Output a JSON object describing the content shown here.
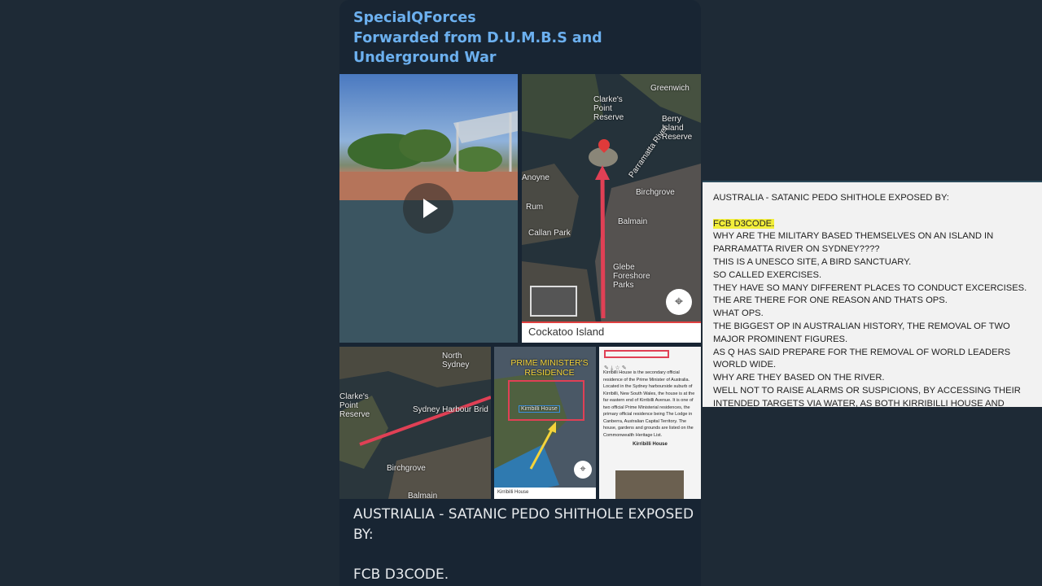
{
  "message": {
    "channel": "SpecialQForces",
    "forwarded_from": "Forwarded from D.U.M.B.S and Underground War",
    "caption_line1": "AUSTRIALIA - SATANIC PEDO SHITHOLE EXPOSED BY:",
    "caption_line2": "FCB D3CODE."
  },
  "media": {
    "map1": {
      "labels": [
        "Greenwich",
        "Clarke's Point Reserve",
        "Berry Island Reserve",
        "Parramatta River",
        "Birchgrove",
        "Balmain",
        "Callan Park",
        "Rum",
        "Glebe Foreshore Parks",
        "Anoyne"
      ],
      "place_box": "Cockatoo Island"
    },
    "map2": {
      "labels": [
        "North Sydney",
        "Clarke's Point Reserve",
        "Sydney Harbour Brid",
        "Birchgrove",
        "Balmain"
      ]
    },
    "map3": {
      "title": "PRIME MINISTER'S RESIDENCE",
      "label": "Kirribilli House",
      "bottom_label": "Kirribilli House"
    },
    "wiki": {
      "text": "Kirribilli House is the secondary official residence of the Prime Minister of Australia. Located in the Sydney harbourside suburb of Kirribilli, New South Wales, the house is at the far eastern end of Kirribilli Avenue. It is one of two official Prime Ministerial residences, the primary official residence being The Lodge in Canberra, Australian Capital Territory. The house, gardens and grounds are listed on the Commonwealth Heritage List.",
      "caption": "Kirribilli House"
    }
  },
  "panel": {
    "title": "AUSTRALIA - SATANIC PEDO SHITHOLE EXPOSED BY:",
    "highlight": "FCB D3CODE.",
    "lines": [
      "WHY ARE THE MILITARY BASED THEMSELVES ON AN ISLAND IN PARRAMATTA RIVER ON SYDNEY????",
      "THIS IS A UNESCO SITE, A BIRD SANCTUARY.",
      "SO CALLED EXERCISES.",
      "THEY HAVE SO MANY DIFFERENT PLACES TO CONDUCT EXCERCISES.",
      "THE ARE THERE FOR ONE REASON AND THATS OPS.",
      "WHAT OPS.",
      "THE BIGGEST OP IN AUSTRALIAN HISTORY, THE REMOVAL OF TWO MAJOR PROMINENT FIGURES.",
      "AS Q HAS SAID PREPARE FOR THE REMOVAL OF WORLD LEADERS WORLD WIDE.",
      "WHY ARE THEY BASED ON THE RIVER.",
      "WELL NOT TO RAISE ALARMS OR SUSPICIONS, BY ACCESSING THEIR INTENDED TARGETS VIA WATER, AS BOTH KIRRIBILLI HOUSE AND"
    ]
  },
  "colors": {
    "background": "#1e2a36",
    "bubble": "#182533",
    "channel_name": "#6cb0ef",
    "highlight": "#f2ee3a",
    "annotation_red": "#e04055",
    "annotation_yellow": "#f4d33a"
  }
}
